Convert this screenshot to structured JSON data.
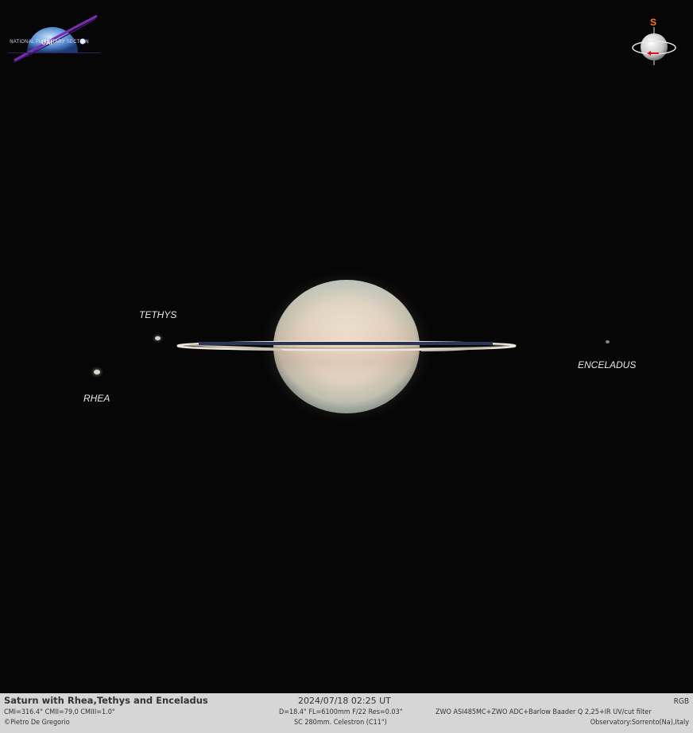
{
  "logo": {
    "abbr": "UAI",
    "org": "NATIONAL PLANETARY SECTION"
  },
  "compass": {
    "direction": "S"
  },
  "moons": {
    "tethys": "TETHYS",
    "rhea": "RHEA",
    "enceladus": "ENCELADUS"
  },
  "footer": {
    "title": "Saturn with Rhea,Tethys and Enceladus",
    "cm": "CMI=316.4° CMII=79,0 CMIII=1.0°",
    "author": "©Pietro De Gregorio",
    "datetime": "2024/07/18   02:25 UT",
    "params": "D=18.4\" FL=6100mm F/22  Res=0.03\"",
    "telescope": "SC 280mm. Celestron (C11\")",
    "mode": "RGB",
    "camera": "ZWO ASI485MC+ZWO ADC+Barlow Baader Q 2,25+IR UV/cut filter",
    "observatory": "Observatory:Sorrento(Na),Italy"
  },
  "colors": {
    "sky": "#060606",
    "footer_bg": "#d6d6d6",
    "compass_s": "#ff7a1a",
    "compass_arrow": "#e01010"
  }
}
